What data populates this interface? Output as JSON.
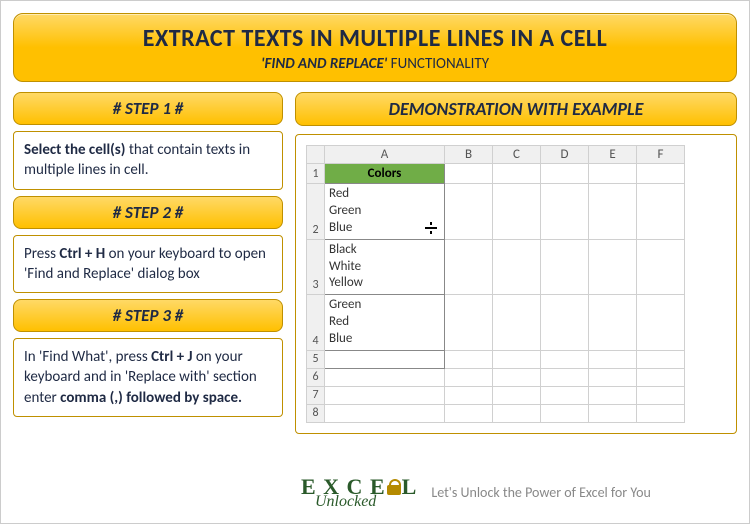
{
  "title": {
    "main": "EXTRACT TEXTS IN MULTIPLE LINES IN A CELL",
    "sub_em": "'FIND AND REPLACE'",
    "sub_rest": " FUNCTIONALITY"
  },
  "steps": {
    "s1": {
      "header": "# STEP 1 #",
      "b1": "Select the cell(s)",
      "t1": " that contain texts in multiple lines in cell."
    },
    "s2": {
      "header": "# STEP 2 #",
      "t1": "Press ",
      "b1": "Ctrl + H",
      "t2": " on your keyboard to open 'Find and Replace' dialog box"
    },
    "s3": {
      "header": "# STEP 3 #",
      "t1": "In 'Find What', press ",
      "b1": "Ctrl + J",
      "t2": " on your keyboard and in 'Replace with' section enter ",
      "b2": "comma (,) followed by space."
    }
  },
  "demo": {
    "header": "DEMONSTRATION WITH EXAMPLE"
  },
  "sheet": {
    "cols": {
      "A": "A",
      "B": "B",
      "C": "C",
      "D": "D",
      "E": "E",
      "F": "F"
    },
    "rows": {
      "r1": "1",
      "r2": "2",
      "r3": "3",
      "r4": "4",
      "r5": "5",
      "r6": "6",
      "r7": "7",
      "r8": "8"
    },
    "a1": "Colors",
    "a2": {
      "l1": "Red",
      "l2": "Green",
      "l3": "Blue"
    },
    "a3": {
      "l1": "Black",
      "l2": "White",
      "l3": "Yellow"
    },
    "a4": {
      "l1": "Green",
      "l2": "Red",
      "l3": "Blue"
    }
  },
  "footer": {
    "logo_top_pre": "E X C E ",
    "logo_top_post": " L",
    "logo_bot": "Unlocked",
    "tagline": "Let's Unlock the Power of Excel for You"
  }
}
